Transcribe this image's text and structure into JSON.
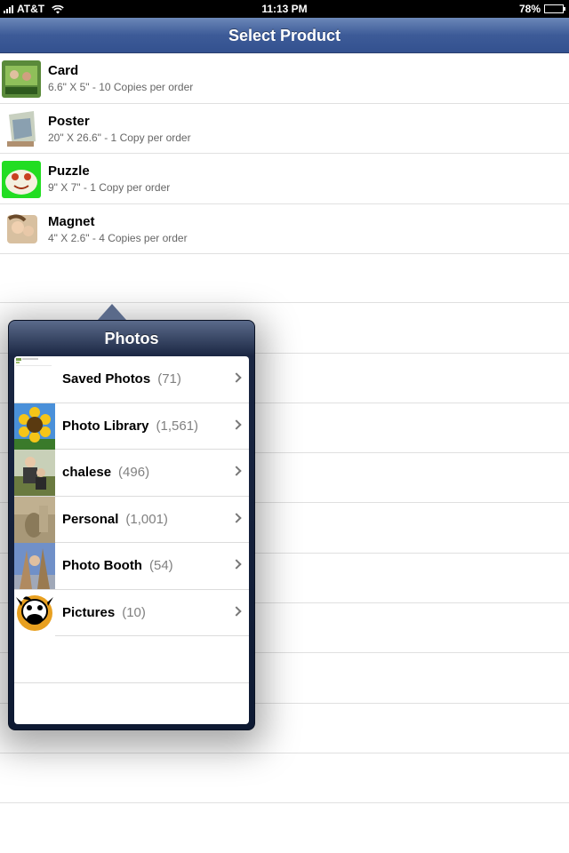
{
  "status_bar": {
    "carrier": "AT&T",
    "time": "11:13 PM",
    "battery_percent": "78%",
    "battery_level": 0.78
  },
  "navbar": {
    "title": "Select Product"
  },
  "products": [
    {
      "title": "Card",
      "subtitle": "6.6\" X 5\" - 10 Copies per order",
      "icon": "card-thumbnail"
    },
    {
      "title": "Poster",
      "subtitle": "20\" X 26.6\" - 1 Copy per order",
      "icon": "poster-thumbnail"
    },
    {
      "title": "Puzzle",
      "subtitle": "9\" X 7\" - 1 Copy per order",
      "icon": "puzzle-thumbnail"
    },
    {
      "title": "Magnet",
      "subtitle": "4\" X 2.6\" - 4 Copies per order",
      "icon": "magnet-thumbnail"
    }
  ],
  "popover": {
    "title": "Photos",
    "albums": [
      {
        "name": "Saved Photos",
        "count": "(71)",
        "icon": "saved-photos-thumbnail"
      },
      {
        "name": "Photo Library",
        "count": "(1,561)",
        "icon": "sunflower-thumbnail"
      },
      {
        "name": "chalese",
        "count": "(496)",
        "icon": "chalese-thumbnail"
      },
      {
        "name": "Personal",
        "count": "(1,001)",
        "icon": "personal-thumbnail"
      },
      {
        "name": "Photo Booth",
        "count": "(54)",
        "icon": "photo-booth-thumbnail"
      },
      {
        "name": "Pictures",
        "count": "(10)",
        "icon": "cow-thumbnail"
      }
    ]
  },
  "colors": {
    "navbar": "#3d5b98",
    "popover": "#1a2642"
  }
}
